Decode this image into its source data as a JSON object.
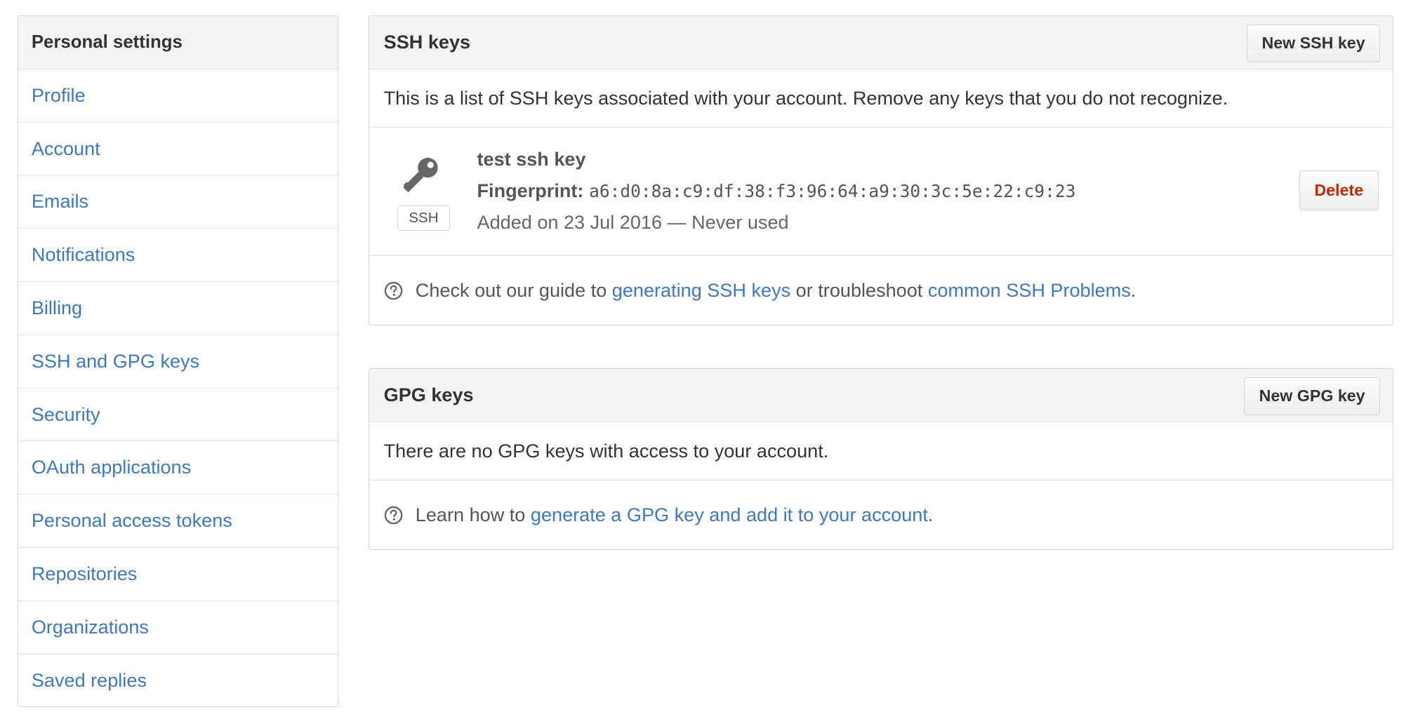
{
  "sidebar": {
    "title": "Personal settings",
    "items": [
      {
        "label": "Profile"
      },
      {
        "label": "Account"
      },
      {
        "label": "Emails"
      },
      {
        "label": "Notifications"
      },
      {
        "label": "Billing"
      },
      {
        "label": "SSH and GPG keys"
      },
      {
        "label": "Security"
      },
      {
        "label": "OAuth applications"
      },
      {
        "label": "Personal access tokens"
      },
      {
        "label": "Repositories"
      },
      {
        "label": "Organizations"
      },
      {
        "label": "Saved replies"
      }
    ]
  },
  "ssh": {
    "title": "SSH keys",
    "new_button": "New SSH key",
    "description": "This is a list of SSH keys associated with your account. Remove any keys that you do not recognize.",
    "key": {
      "icon": "key-icon",
      "type_label": "SSH",
      "title": "test ssh key",
      "fingerprint_label": "Fingerprint:",
      "fingerprint": "a6:d0:8a:c9:df:38:f3:96:64:a9:30:3c:5e:22:c9:23",
      "added": "Added on 23 Jul 2016 — Never used",
      "delete_button": "Delete"
    },
    "help": {
      "icon": "question-icon",
      "prefix": "Check out our guide to ",
      "link1": "generating SSH keys",
      "middle": " or troubleshoot ",
      "link2": "common SSH Problems",
      "suffix": "."
    }
  },
  "gpg": {
    "title": "GPG keys",
    "new_button": "New GPG key",
    "description": "There are no GPG keys with access to your account.",
    "help": {
      "icon": "question-icon",
      "prefix": "Learn how to ",
      "link": "generate a GPG key and add it to your account",
      "suffix": "."
    }
  },
  "colors": {
    "link": "#4078c0",
    "danger": "#bd2c00",
    "header_bg": "#f5f5f5",
    "border": "#d1d5da"
  }
}
